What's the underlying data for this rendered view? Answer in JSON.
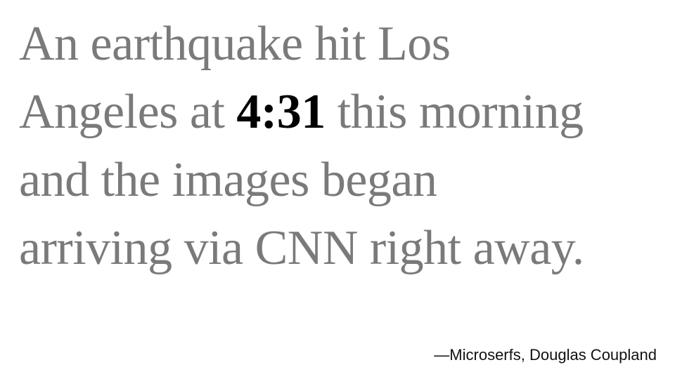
{
  "quote": {
    "line1": "An earthquake hit Los",
    "line2_before": "Angeles at ",
    "line2_highlight": "4:31",
    "line2_after": " this morning",
    "line3": "and the images began",
    "line4": "arriving via CNN right away."
  },
  "attribution": "—Microserfs, Douglas Coupland",
  "colors": {
    "quote_text": "#7a7a7a",
    "highlight": "#000000",
    "attribution": "#111111",
    "background": "#ffffff"
  }
}
